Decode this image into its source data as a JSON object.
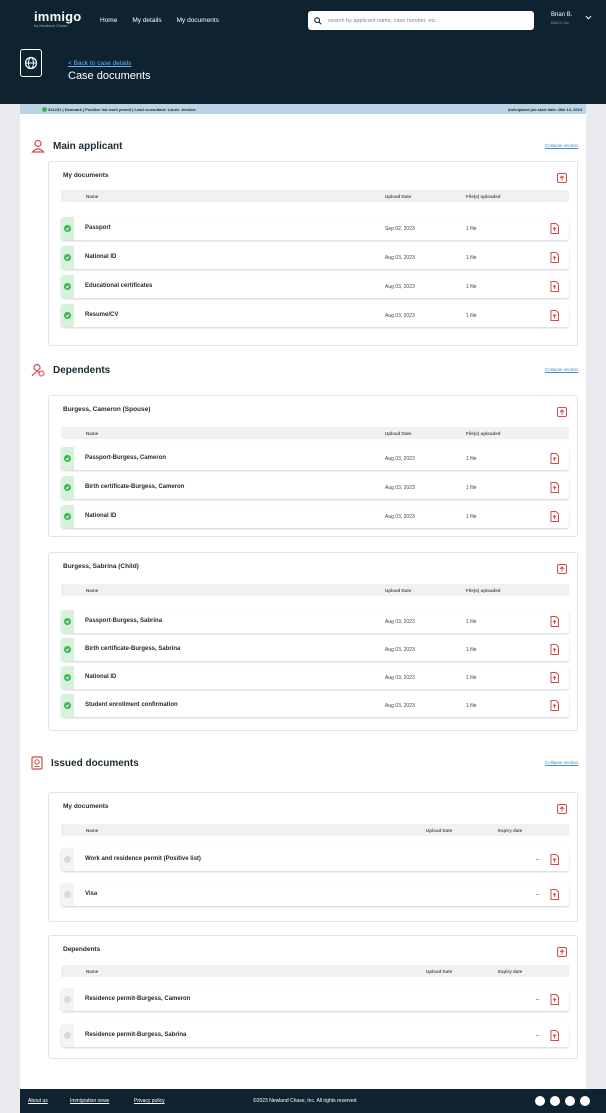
{
  "header": {
    "brand": "immigo",
    "brand_sub": "by Newland Chase",
    "nav": [
      "Home",
      "My details",
      "My documents"
    ],
    "search_placeholder": "search by applicant name, case number, etc.",
    "user_name": "Brian B.",
    "user_sub": "NACO Inc"
  },
  "hero": {
    "back_link": "< Back to case details",
    "title": "Case documents"
  },
  "infobar": {
    "left": "321231 | Denmark | Positive list work permit | Lead consultant: Laurie Jenkins",
    "right": "Anticipated job start date: Mar 14, 2024"
  },
  "sections": {
    "main_applicant": "Main applicant",
    "dependents": "Dependents",
    "issued": "Issued documents",
    "collapse": "Collapse section"
  },
  "columns": {
    "name": "Name",
    "upload_date": "Upload Date",
    "files": "File(s) uploaded",
    "expiry": "Expiry date"
  },
  "cards": {
    "my_docs": {
      "title": "My documents",
      "rows": [
        {
          "name": "Passport",
          "date": "Sep 02, 2023",
          "files": "1 file"
        },
        {
          "name": "National ID",
          "date": "Aug 03, 2023",
          "files": "1 file"
        },
        {
          "name": "Educational certificates",
          "date": "Aug 03, 2023",
          "files": "1 file"
        },
        {
          "name": "Resume/CV",
          "date": "Aug 03, 2023",
          "files": "1 file"
        }
      ]
    },
    "spouse": {
      "title": "Burgess, Cameron (Spouse)",
      "rows": [
        {
          "name": "Passport-Burgess, Cameron",
          "date": "Aug 03, 2023",
          "files": "1 file"
        },
        {
          "name": "Birth certificate-Burgess, Cameron",
          "date": "Aug 03, 2023",
          "files": "1 file"
        },
        {
          "name": "National ID",
          "date": "Aug 03, 2023",
          "files": "1 file"
        }
      ]
    },
    "child": {
      "title": "Burgess, Sabrina (Child)",
      "rows": [
        {
          "name": "Passport-Burgess, Sabrina",
          "date": "Aug 03, 2023",
          "files": "1 file"
        },
        {
          "name": "Birth certificate-Burgess, Sabrina",
          "date": "Aug 03, 2023",
          "files": "1 file"
        },
        {
          "name": "National ID",
          "date": "Aug 03, 2023",
          "files": "1 file"
        },
        {
          "name": "Student enrollment confirmation",
          "date": "Aug 03, 2023",
          "files": "1 file"
        }
      ]
    },
    "issued_my": {
      "title": "My documents",
      "rows": [
        {
          "name": "Work and residence permit (Positive list)",
          "expiry": "–"
        },
        {
          "name": "Visa",
          "expiry": "–"
        }
      ]
    },
    "issued_dep": {
      "title": "Dependents",
      "rows": [
        {
          "name": "Residence permit-Burgess, Cameron",
          "expiry": "–"
        },
        {
          "name": "Residence permit-Burgess, Sabrina",
          "expiry": "–"
        }
      ]
    }
  },
  "footer": {
    "links": [
      "About us",
      "Immigration news",
      "Privacy policy"
    ],
    "copyright": "©2023 Newland Chase, Inc. All rights reserved",
    "social": [
      "facebook-icon",
      "x-icon",
      "linkedin-icon",
      "instagram-icon"
    ]
  },
  "colors": {
    "navy": "#0f2230",
    "accent_red": "#d14b4b",
    "success": "#3cb552",
    "link": "#3a8dd8"
  }
}
